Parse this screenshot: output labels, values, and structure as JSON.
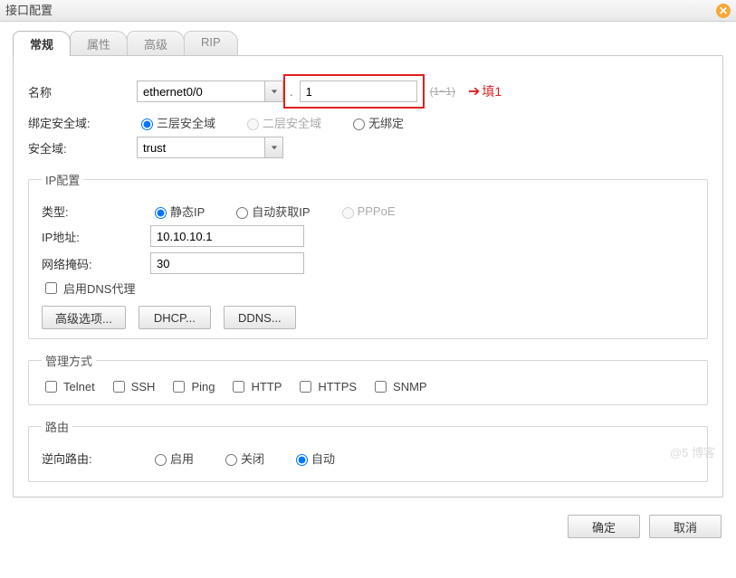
{
  "window": {
    "title": "接口配置"
  },
  "tabs": {
    "general": "常规",
    "attrs": "属性",
    "advanced": "高级",
    "rip": "RIP"
  },
  "general": {
    "name_label": "名称",
    "name_combo": "ethernet0/0",
    "sub_value": "1",
    "range_hint": "(1~1)",
    "annotation": "填1",
    "bind_domain_label": "绑定安全域:",
    "bind_opts": {
      "l3": "三层安全域",
      "l2": "二层安全域",
      "none": "无绑定"
    },
    "sec_domain_label": "安全域:",
    "sec_domain_value": "trust"
  },
  "ipcfg": {
    "legend": "IP配置",
    "type_label": "类型:",
    "type_opts": {
      "static": "静态IP",
      "auto": "自动获取IP",
      "pppoe": "PPPoE"
    },
    "ip_label": "IP地址:",
    "ip_value": "10.10.10.1",
    "mask_label": "网络掩码:",
    "mask_value": "30",
    "dns_proxy": "启用DNS代理",
    "btn_adv": "高级选项...",
    "btn_dhcp": "DHCP...",
    "btn_ddns": "DDNS..."
  },
  "mgmt": {
    "legend": "管理方式",
    "opts": {
      "telnet": "Telnet",
      "ssh": "SSH",
      "ping": "Ping",
      "http": "HTTP",
      "https": "HTTPS",
      "snmp": "SNMP"
    }
  },
  "route": {
    "legend": "路由",
    "rev_label": "逆向路由:",
    "opts": {
      "enable": "启用",
      "disable": "关闭",
      "auto": "自动"
    }
  },
  "footer": {
    "ok": "确定",
    "cancel": "取消"
  },
  "watermark": "@5  博客"
}
